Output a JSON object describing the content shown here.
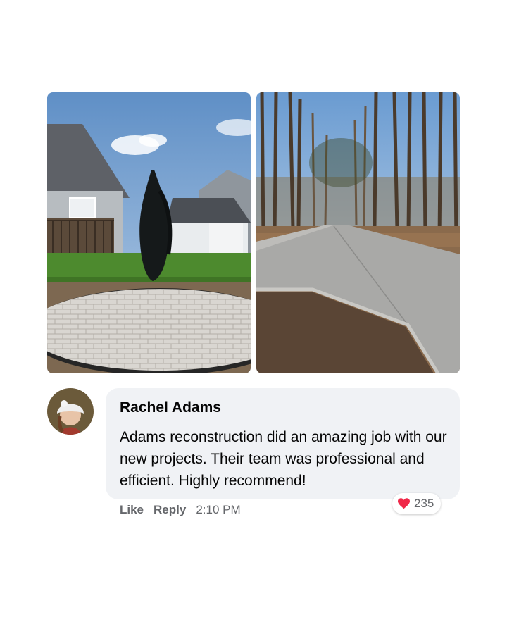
{
  "photos": [
    {
      "icon": "stamped-concrete-patio-photo"
    },
    {
      "icon": "concrete-driveway-photo"
    }
  ],
  "comment": {
    "avatar_icon": "profile-photo-avatar",
    "author": "Rachel Adams",
    "text": "Adams reconstruction did an amazing job with our new projects. Their team was professional and efficient. Highly recommend!",
    "bubble_color": "#f0f2f5"
  },
  "actions": {
    "like_label": "Like",
    "reply_label": "Reply",
    "timestamp": "2:10 PM"
  },
  "reactions": {
    "icon": "heart-icon",
    "heart_color": "#f02849",
    "count": "235"
  }
}
